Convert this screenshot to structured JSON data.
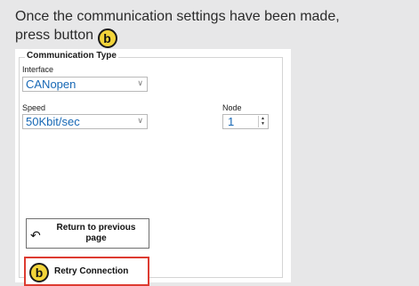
{
  "instruction": {
    "line1": "Once the communication settings have been made,",
    "line2_prefix": "press button",
    "badge": "b"
  },
  "communication_type": {
    "title": "Communication Type",
    "interface_label": "Interface",
    "interface_value": "CANopen",
    "speed_label": "Speed",
    "speed_value": "50Kbit/sec",
    "node_label": "Node",
    "node_value": "1"
  },
  "buttons": {
    "return_label": "Return to previous page",
    "retry_badge": "b",
    "retry_label": "Retry Connection"
  },
  "icons": {
    "dropdown": "chevron-down-icon",
    "spinner": "spinner-arrows-icon",
    "return": "return-arrow-icon"
  },
  "colors": {
    "highlight": "#dd3b31",
    "badge_fill": "#f2d43a",
    "value_text": "#1768b5"
  }
}
